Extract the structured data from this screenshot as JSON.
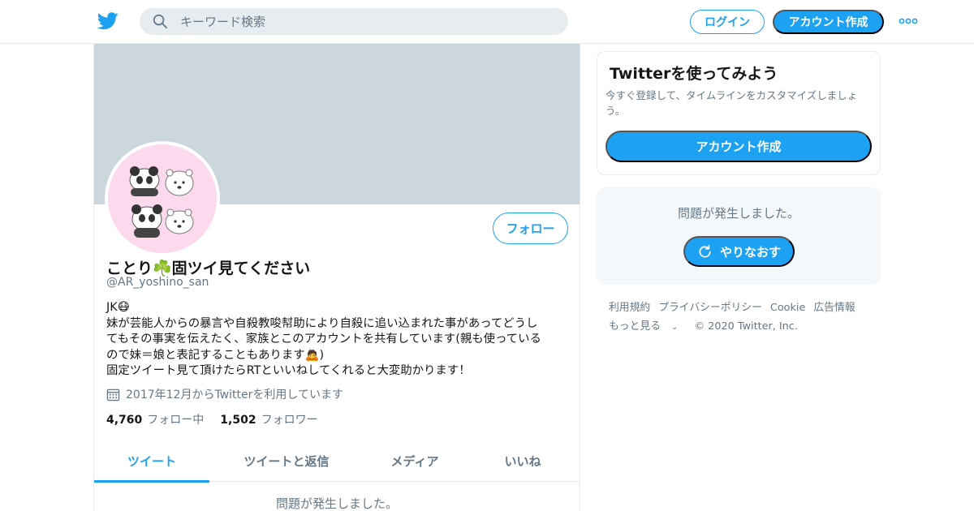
{
  "header": {
    "search_placeholder": "キーワード検索",
    "login_label": "ログイン",
    "signup_label": "アカウント作成"
  },
  "profile": {
    "follow_label": "フォロー",
    "display_name": "ことり☘️固ツイ見てください",
    "handle": "@AR_yoshino_san",
    "bio_lines": [
      "JK😷",
      "妹が芸能人からの暴言や自殺教唆幇助により自殺に追い込まれた事があってどうし",
      "てもその事実を伝えたく、家族とこのアカウントを共有しています(親も使っている",
      "ので妹＝娘と表記することもあります🙇)",
      "固定ツイート見て頂けたらRTといいねしてくれると大変助かります！"
    ],
    "joined": "2017年12月からTwitterを利用しています",
    "following_count": "4,760",
    "following_label": "フォロー中",
    "followers_count": "1,502",
    "followers_label": "フォロワー"
  },
  "tabs": [
    {
      "label": "ツイート",
      "active": true
    },
    {
      "label": "ツイートと返信",
      "active": false
    },
    {
      "label": "メディア",
      "active": false
    },
    {
      "label": "いいね",
      "active": false
    }
  ],
  "timeline": {
    "error_message": "問題が発生しました。"
  },
  "signup_card": {
    "title": "Twitterを使ってみよう",
    "description": "今すぐ登録して、タイムラインをカスタマイズしましょう。",
    "button_label": "アカウント作成"
  },
  "error_card": {
    "message": "問題が発生しました。",
    "retry_label": "やりなおす"
  },
  "footer": {
    "links": [
      "利用規約",
      "プライバシーポリシー",
      "Cookie",
      "広告情報"
    ],
    "more_label": "もっと見る",
    "copyright": "© 2020 Twitter, Inc."
  },
  "colors": {
    "accent": "#1da1f2",
    "banner": "#ccd6dd",
    "muted_text": "#657786",
    "avatar_background": "#fcd9ec"
  },
  "icons": [
    "twitter-bird-icon",
    "search-icon",
    "more-dots-icon",
    "calendar-icon",
    "retry-icon",
    "chevron-down-icon"
  ]
}
